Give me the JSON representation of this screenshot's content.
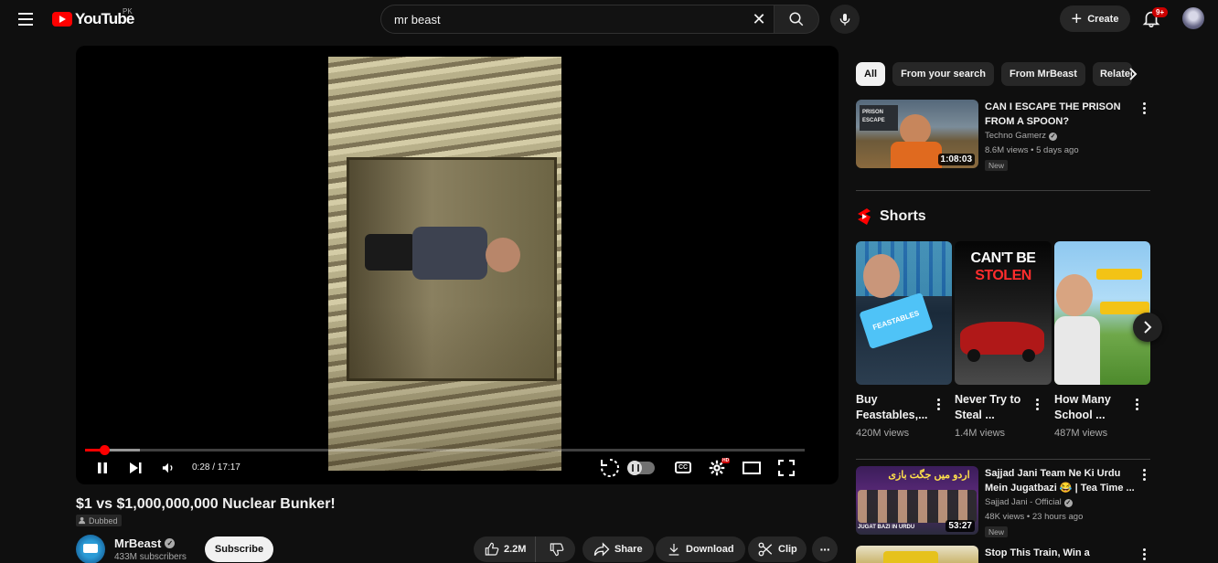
{
  "header": {
    "logo_text": "YouTube",
    "country": "PK",
    "search_value": "mr beast",
    "search_placeholder": "Search",
    "create_label": "Create",
    "notifications_badge": "9+"
  },
  "player": {
    "current_time": "0:28",
    "duration": "17:17",
    "time_display": "0:28 / 17:17",
    "played_fraction": 0.027,
    "buffered_fraction": 0.076,
    "hd_badge": "HD",
    "cc_label": "CC"
  },
  "video": {
    "title": "$1 vs $1,000,000,000 Nuclear Bunker!",
    "dubbed_label": "Dubbed",
    "channel_name": "MrBeast",
    "subscribers": "433M subscribers",
    "subscribe_label": "Subscribe",
    "likes": "2.2M",
    "share_label": "Share",
    "download_label": "Download",
    "clip_label": "Clip"
  },
  "sidebar": {
    "chips": [
      "All",
      "From your search",
      "From MrBeast",
      "Related"
    ],
    "recommendations": [
      {
        "title_line1": "CAN I ESCAPE THE PRISON",
        "title_line2": "FROM A SPOON?",
        "channel": "Techno Gamerz",
        "meta": "8.6M views • 5 days ago",
        "duration": "1:08:03",
        "badge": "New",
        "thumb_text": "PRISON ESCAPE"
      },
      {
        "title_line1": "Sajjad Jani Team Ne Ki Urdu",
        "title_line2": "Mein Jugatbazi 😂 | Tea Time ...",
        "channel": "Sajjad Jani - Official",
        "meta": "48K views • 23 hours ago",
        "duration": "53:27",
        "badge": "New",
        "thumb_text": "اردو میں جگت بازی",
        "thumb_caption": "JUGAT BAZI IN URDU"
      },
      {
        "title_line1": "Stop This Train, Win a"
      }
    ],
    "shorts_label": "Shorts",
    "shorts": [
      {
        "title_line1": "Buy",
        "title_line2": "Feastables,...",
        "views": "420M views",
        "thumb_text": "FEASTABLES"
      },
      {
        "title_line1": "Never Try to",
        "title_line2": "Steal ...",
        "views": "1.4M views",
        "thumb_line1": "CAN'T BE",
        "thumb_line2": "STOLEN"
      },
      {
        "title_line1": "How Many",
        "title_line2": "School ...",
        "views": "487M views"
      }
    ]
  },
  "colors": {
    "background": "#0f0f0f",
    "accent_red": "#ff0000",
    "text_primary": "#f1f1f1",
    "text_secondary": "#aaaaaa",
    "surface": "#272727"
  }
}
